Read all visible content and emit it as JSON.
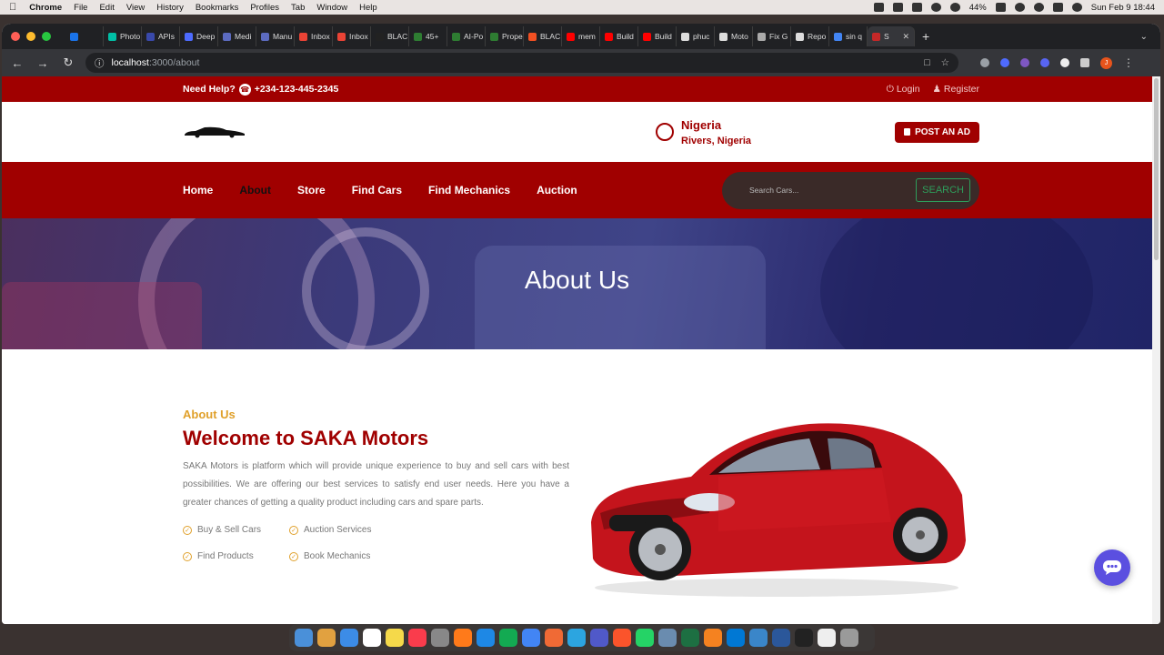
{
  "menubar": {
    "app": "Chrome",
    "items": [
      "File",
      "Edit",
      "View",
      "History",
      "Bookmarks",
      "Profiles",
      "Tab",
      "Window",
      "Help"
    ],
    "battery": "44%",
    "datetime": "Sun Feb 9  18:44"
  },
  "browser": {
    "tabs": [
      {
        "label": "",
        "color": "#1a73e8"
      },
      {
        "label": "Photo",
        "color": "#00bfa5"
      },
      {
        "label": "APIs",
        "color": "#3949ab"
      },
      {
        "label": "Deep",
        "color": "#4d6bfe"
      },
      {
        "label": "Medi",
        "color": "#5c6bc0"
      },
      {
        "label": "Manu",
        "color": "#5c6bc0"
      },
      {
        "label": "Inbox",
        "color": "#ea4335"
      },
      {
        "label": "Inbox",
        "color": "#ea4335"
      },
      {
        "label": "BLAC",
        "color": "#222222"
      },
      {
        "label": "45+",
        "color": "#2e7d32"
      },
      {
        "label": "AI-Po",
        "color": "#2e7d32"
      },
      {
        "label": "Prope",
        "color": "#2e7d32"
      },
      {
        "label": "BLAC",
        "color": "#f25022"
      },
      {
        "label": "mem",
        "color": "#ff0000"
      },
      {
        "label": "Build",
        "color": "#ff0000"
      },
      {
        "label": "Build",
        "color": "#ff0000"
      },
      {
        "label": "phuc",
        "color": "#dddddd"
      },
      {
        "label": "Moto",
        "color": "#dddddd"
      },
      {
        "label": "Fix G",
        "color": "#aaaaaa"
      },
      {
        "label": "Repo",
        "color": "#dddddd"
      },
      {
        "label": "sin q",
        "color": "#4285f4"
      }
    ],
    "active_tab": {
      "label": "S",
      "color": "#c62828"
    },
    "url_host": "localhost",
    "url_path": ":3000/about"
  },
  "site": {
    "topbar": {
      "help_label": "Need Help?",
      "phone": "+234-123-445-2345",
      "login": "Login",
      "register": "Register"
    },
    "header": {
      "country": "Nigeria",
      "region": "Rivers, Nigeria",
      "post_ad": "POST AN AD"
    },
    "nav": {
      "links": [
        "Home",
        "About",
        "Store",
        "Find Cars",
        "Find Mechanics",
        "Auction"
      ],
      "active": "About",
      "search_placeholder": "Search Cars...",
      "search_button": "SEARCH"
    },
    "hero": {
      "title": "About Us"
    },
    "about": {
      "kicker": "About Us",
      "heading": "Welcome to SAKA Motors",
      "body": "SAKA Motors is platform which will provide unique experience to buy and sell cars with best possibilities. We are offering our best services to satisfy end user needs. Here you have a greater chances of getting a quality product including cars and spare parts.",
      "features": [
        "Buy & Sell Cars",
        "Auction Services",
        "Find Products",
        "Book Mechanics"
      ]
    }
  },
  "colors": {
    "brand_red": "#a00000",
    "accent_gold": "#e0a02a",
    "search_green": "#2e9e5b",
    "chat_purple": "#5b4fe0"
  },
  "dock_apps": [
    "#4a90d9",
    "#e1a140",
    "#3c8ce7",
    "#ffffff",
    "#f5d94a",
    "#fa3c4c",
    "#888888",
    "#ff7a1a",
    "#1e88e5",
    "#13aa52",
    "#4285f4",
    "#f06a35",
    "#2ca5e0",
    "#5059c9",
    "#fb542b",
    "#25d366",
    "#6a8caf",
    "#1d6f42",
    "#f58220",
    "#0078d4",
    "#3a86c9",
    "#2b579a",
    "#222222",
    "#eeeeee",
    "#9a9a9a"
  ]
}
